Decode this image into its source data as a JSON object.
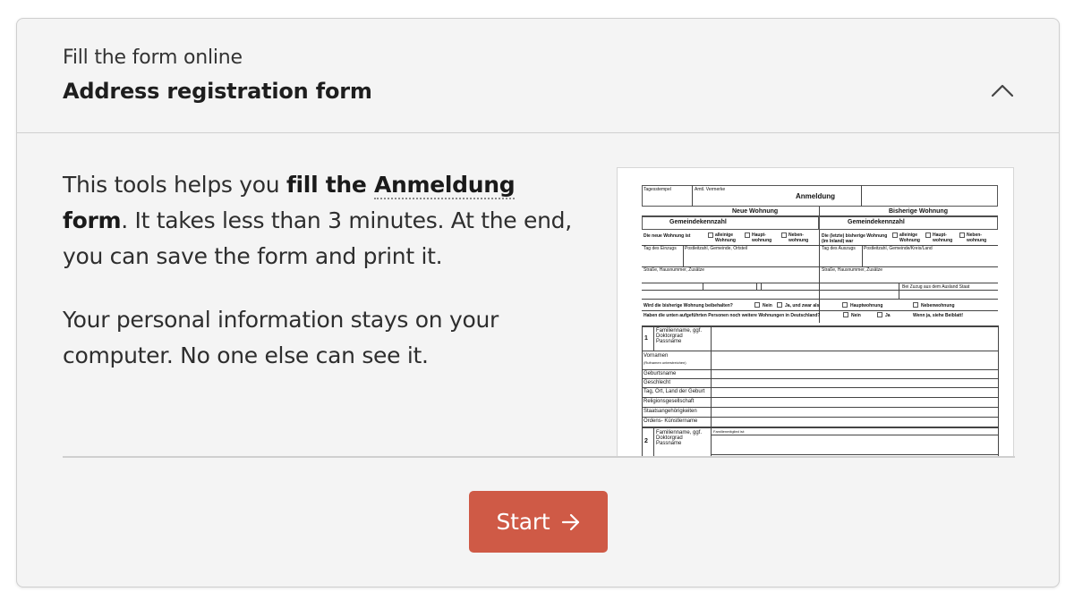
{
  "header": {
    "kicker": "Fill the form online",
    "title": "Address registration form",
    "toggle_icon": "chevron-up-icon"
  },
  "body": {
    "p1_before": "This tools helps you ",
    "p1_bold_prefix": "fill the ",
    "p1_term": "Anmeldung",
    "p1_bold_suffix": " form",
    "p1_after": ". It takes less than 3 minutes. At the end, you can save the form and print it.",
    "p2": "Your personal information stays on your computer. No one else can see it."
  },
  "form_preview": {
    "stamp": "Tagesstempel",
    "notes": "Amtl. Vermerke",
    "title": "Anmeldung",
    "col_new": "Neue Wohnung",
    "col_old": "Bisherige Wohnung",
    "municipality_code": "Gemeindekennzahl",
    "new_flat_is": "Die neue Wohnung ist",
    "old_flat_was": "Die (letzte) bisherige Wohnung (im Inland) war",
    "opt_sole": "alleinige Wohnung",
    "opt_main": "Haupt-wohnung",
    "opt_secondary": "Neben-wohnung",
    "move_in_date": "Tag des Einzugs",
    "move_out_date": "Tag des Auszugs",
    "postcode_new": "Postleitzahl, Gemeinde, Ortsteil",
    "postcode_old": "Postleitzahl, Gemeinde/Kreis/Land",
    "street_new": "Straße, Hausnummer, Zusätze",
    "street_old": "Straße, Hausnummer, Zusätze",
    "abroad": "Bei Zuzug aus dem Ausland Staat",
    "keep_old": "Wird die bisherige Wohnung beibehalten?",
    "no": "Nein",
    "yes_as": "Ja, und zwar als",
    "main_flat": "Hauptwohnung",
    "secondary_flat": "Nebenwohnung",
    "other_flats": "Haben die unten aufgeführten Personen noch weitere Wohnungen in Deutschland?",
    "yes": "Ja",
    "if_yes": "Wenn ja, siehe Beiblatt!",
    "p1_num": "1",
    "p2_num": "2",
    "surname": "Familienname, ggf. Doktorgrad Passname",
    "first_names": "Vornamen",
    "first_names_note": "(Rufnamen unterstreichen)",
    "birth_name": "Geburtsname",
    "gender": "Geschlecht",
    "birth_place": "Tag, Ort, Land der Geburt",
    "religion": "Religionsgesellschaft",
    "nationality": "Staatsangehörigkeiten",
    "artist_name": "Ordens- Künstlername",
    "family_member": "Familienmitglied ist:"
  },
  "actions": {
    "start_label": "Start",
    "start_icon": "arrow-right-icon"
  },
  "colors": {
    "card_bg": "#f4f4f4",
    "border": "#cfcfcf",
    "primary_button": "#cf5a46"
  }
}
